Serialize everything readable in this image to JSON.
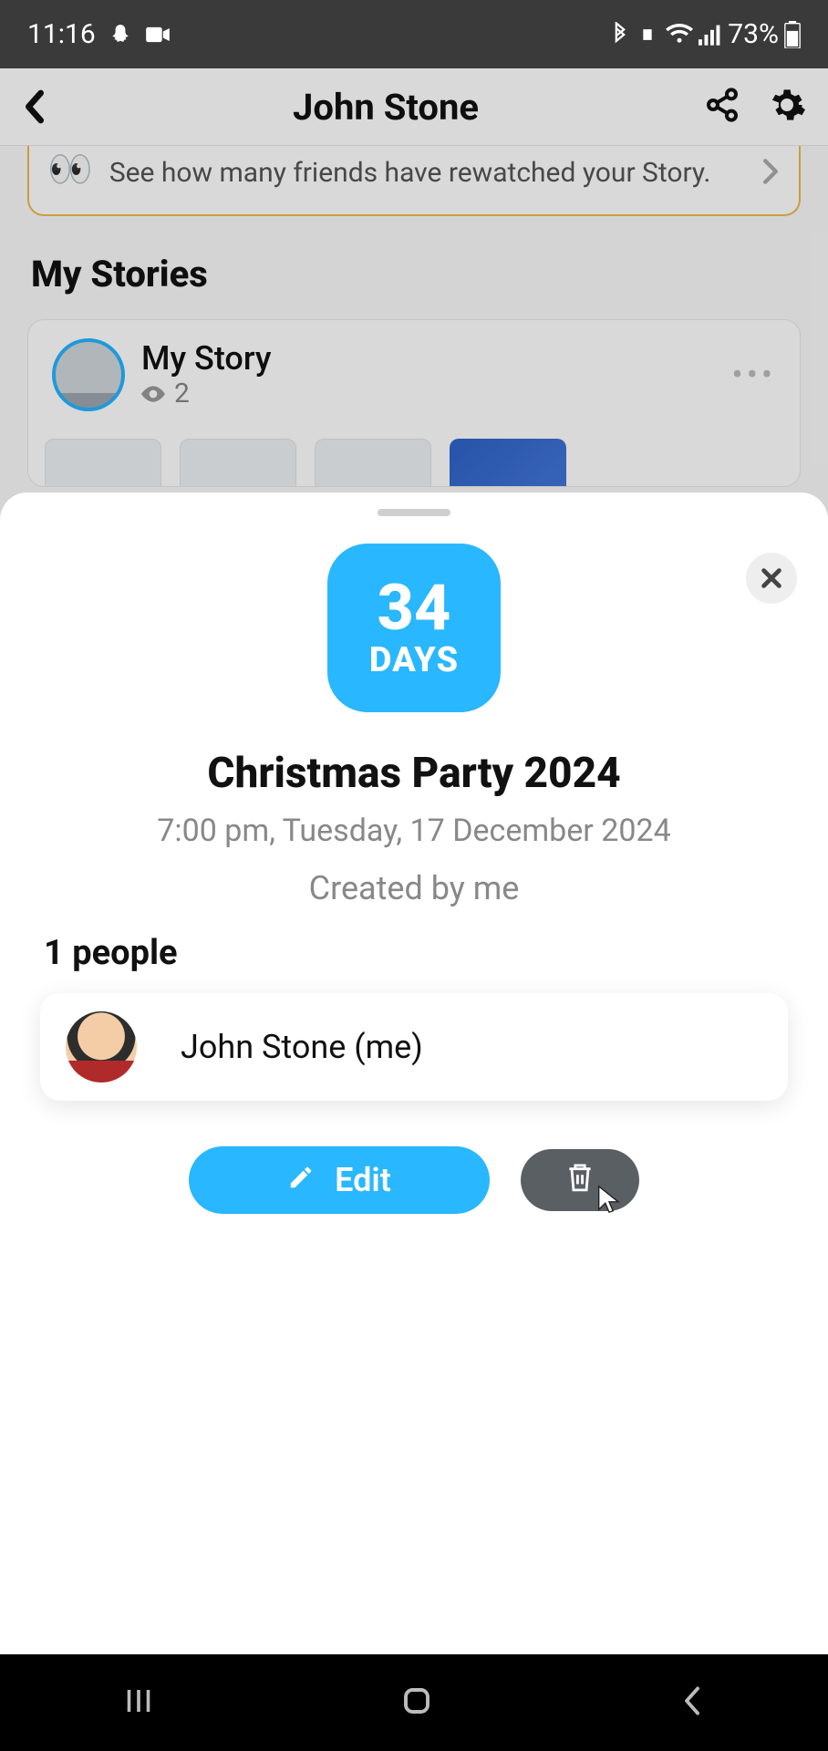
{
  "status": {
    "time": "11:16",
    "battery": "73%"
  },
  "header": {
    "title": "John Stone"
  },
  "rewatch": {
    "text": "See how many friends have rewatched your Story."
  },
  "stories": {
    "heading": "My Stories",
    "story_title": "My Story",
    "views": "2"
  },
  "countdown": {
    "number": "34",
    "unit": "DAYS",
    "title": "Christmas Party 2024",
    "datetime": "7:00 pm, Tuesday, 17 December 2024",
    "created_by": "Created by me",
    "people_count": "1 people",
    "participant": "John Stone (me)",
    "edit_label": "Edit"
  }
}
